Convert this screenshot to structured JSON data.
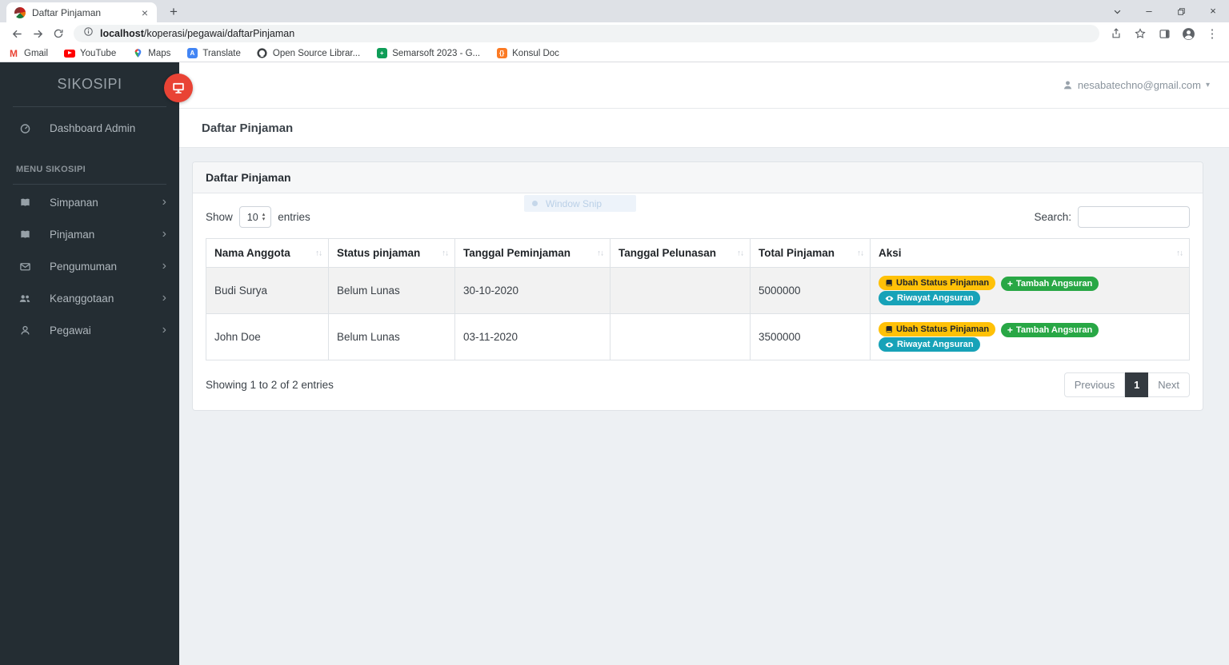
{
  "browser": {
    "tab_title": "Daftar Pinjaman",
    "url_host": "localhost",
    "url_path": "/koperasi/pegawai/daftarPinjaman",
    "bookmarks": [
      {
        "label": "Gmail"
      },
      {
        "label": "YouTube"
      },
      {
        "label": "Maps"
      },
      {
        "label": "Translate"
      },
      {
        "label": "Open Source Librar..."
      },
      {
        "label": "Semarsoft 2023 - G..."
      },
      {
        "label": "Konsul Doc"
      }
    ]
  },
  "sidebar": {
    "brand": "SIKOSIPI",
    "dashboard_label": "Dashboard Admin",
    "section_label": "MENU SIKOSIPI",
    "items": [
      {
        "label": "Simpanan"
      },
      {
        "label": "Pinjaman"
      },
      {
        "label": "Pengumuman"
      },
      {
        "label": "Keanggotaan"
      },
      {
        "label": "Pegawai"
      }
    ]
  },
  "header": {
    "user_email": "nesabatechno@gmail.com"
  },
  "page": {
    "title": "Daftar Pinjaman"
  },
  "card": {
    "title": "Daftar Pinjaman",
    "length": {
      "show_label": "Show",
      "value": "10",
      "entries_label": "entries"
    },
    "search": {
      "label": "Search:",
      "value": ""
    },
    "table": {
      "columns": [
        "Nama Anggota",
        "Status pinjaman",
        "Tanggal Peminjaman",
        "Tanggal Pelunasan",
        "Total Pinjaman",
        "Aksi"
      ],
      "rows": [
        {
          "nama": "Budi Surya",
          "status": "Belum Lunas",
          "tgl_pinjam": "30-10-2020",
          "tgl_lunas": "",
          "total": "5000000"
        },
        {
          "nama": "John Doe",
          "status": "Belum Lunas",
          "tgl_pinjam": "03-11-2020",
          "tgl_lunas": "",
          "total": "3500000"
        }
      ],
      "actions": [
        {
          "label": "Ubah Status Pinjaman",
          "bg": "#ffc107",
          "text": "#212529"
        },
        {
          "label": "Tambah Angsuran",
          "bg": "#28a745",
          "text": "#ffffff"
        },
        {
          "label": "Riwayat Angsuran",
          "bg": "#17a2b8",
          "text": "#ffffff"
        }
      ]
    },
    "info_text": "Showing 1 to 2 of 2 entries",
    "pagination": {
      "previous": "Previous",
      "current": "1",
      "next": "Next"
    }
  },
  "overlay": {
    "window_snip_label": "Window Snip"
  },
  "colors": {
    "accent_red": "#e94335",
    "pagination_active": "#343a40",
    "sidebar_bg": "#242d33"
  }
}
